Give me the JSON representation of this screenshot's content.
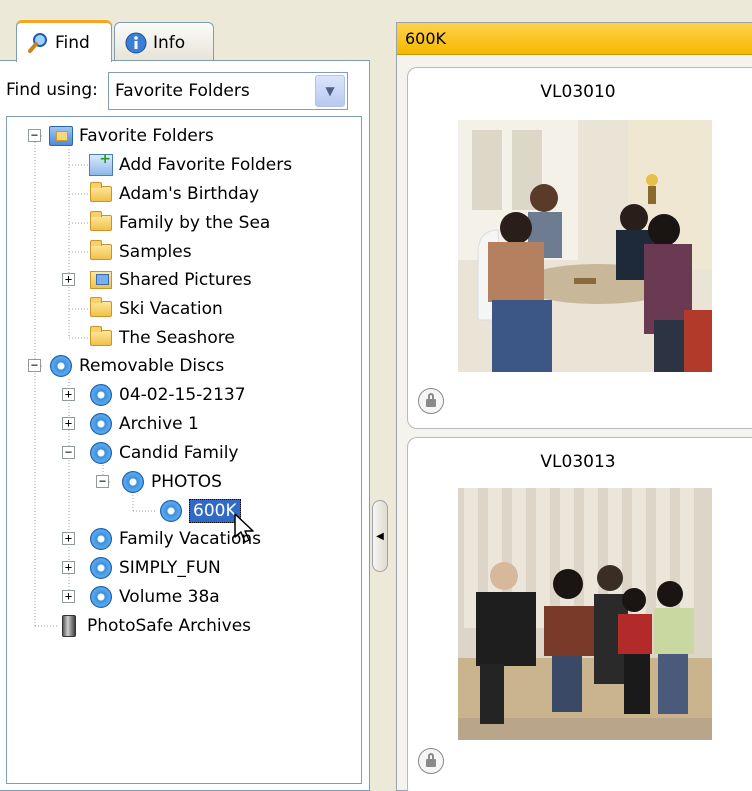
{
  "tabs": {
    "find_label": "Find",
    "info_label": "Info"
  },
  "find_using": {
    "label": "Find using:",
    "selected": "Favorite Folders"
  },
  "tree": {
    "favorite_folders": "Favorite Folders",
    "add_favorite_folders": "Add Favorite Folders",
    "adams_birthday": "Adam's Birthday",
    "family_by_the_sea": "Family by the Sea",
    "samples": "Samples",
    "shared_pictures": "Shared Pictures",
    "ski_vacation": "Ski Vacation",
    "the_seashore": "The Seashore",
    "removable_discs": "Removable Discs",
    "disc_04": "04-02-15-2137",
    "archive_1": "Archive 1",
    "candid_family": "Candid Family",
    "photos": "PHOTOS",
    "600k": "600K",
    "family_vacations": "Family Vacations",
    "simply_fun": "SIMPLY_FUN",
    "volume_38a": "Volume 38a",
    "photosafe_archives": "PhotoSafe Archives"
  },
  "content": {
    "header": "600K",
    "cards": [
      {
        "title": "VL03010"
      },
      {
        "title": "VL03013"
      }
    ]
  },
  "colors": {
    "selection": "#316ac5",
    "header_bar": "#f5b800",
    "tab_accent": "#f5a623",
    "border": "#7f9db9"
  }
}
